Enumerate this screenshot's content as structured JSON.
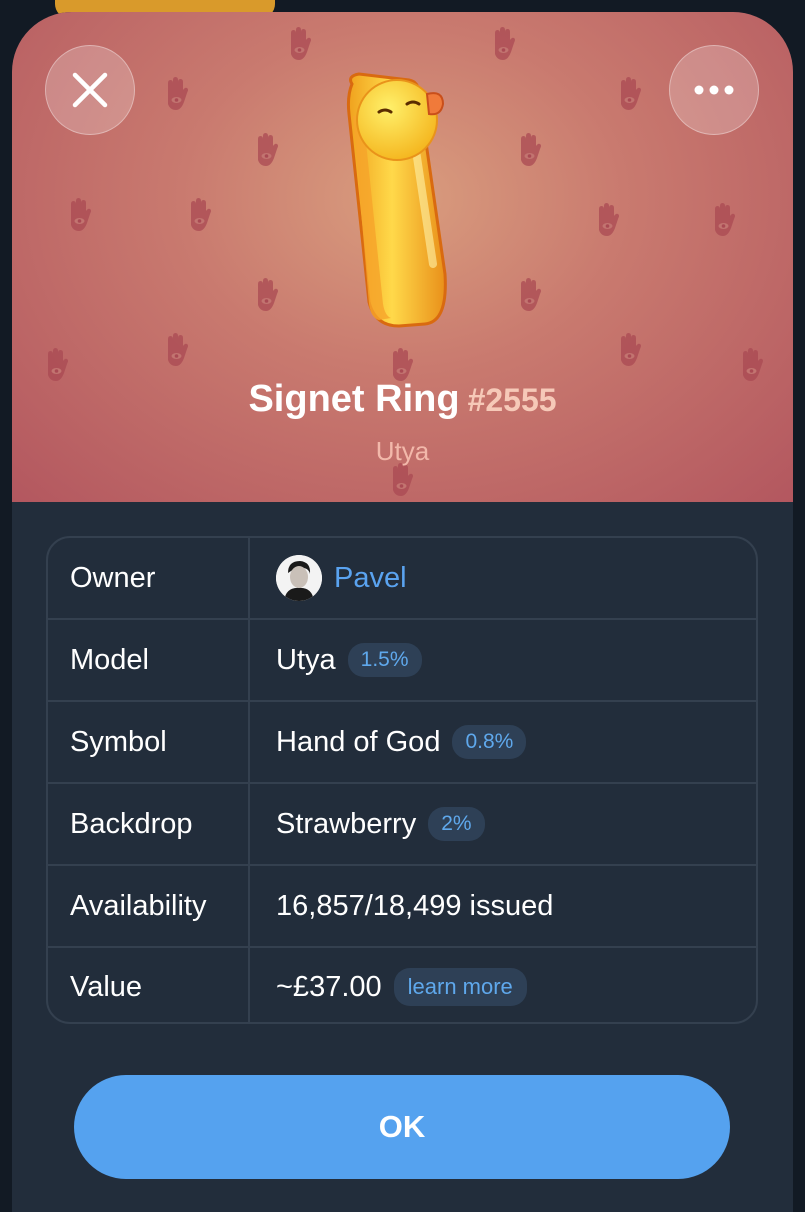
{
  "gift": {
    "name": "Signet Ring",
    "number": "#2555",
    "collection": "Utya"
  },
  "header": {
    "close_icon": "close-icon",
    "more_icon": "more-horizontal-icon",
    "backdrop_color": "#c97a6f",
    "pattern_icon": "hand-of-god-icon"
  },
  "details": {
    "owner": {
      "label": "Owner",
      "value": "Pavel"
    },
    "model": {
      "label": "Model",
      "value": "Utya",
      "rarity": "1.5%"
    },
    "symbol": {
      "label": "Symbol",
      "value": "Hand of God",
      "rarity": "0.8%"
    },
    "backdrop": {
      "label": "Backdrop",
      "value": "Strawberry",
      "rarity": "2%"
    },
    "availability": {
      "label": "Availability",
      "value": "16,857/18,499 issued"
    },
    "value": {
      "label": "Value",
      "value": "~£37.00",
      "link": "learn more"
    }
  },
  "actions": {
    "ok_label": "OK"
  },
  "colors": {
    "accent": "#55a2ef",
    "link": "#5aa3f0",
    "sheet": "#222d3b"
  }
}
